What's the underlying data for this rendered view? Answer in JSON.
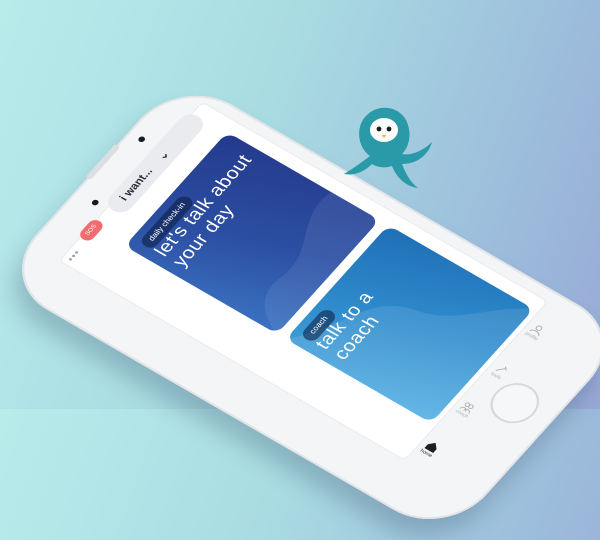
{
  "header": {
    "want_label": "i want...",
    "pill_label": "SOS"
  },
  "cards": [
    {
      "tag": "daily check-in",
      "text": "let's talk about your day"
    },
    {
      "tag": "coach",
      "text": "talk to a coach"
    }
  ],
  "tabs": [
    {
      "label": "home",
      "icon": "home-icon",
      "active": true
    },
    {
      "label": "coach",
      "icon": "people-icon",
      "active": false
    },
    {
      "label": "tools",
      "icon": "tools-icon",
      "active": false
    },
    {
      "label": "profile",
      "icon": "profile-icon",
      "active": false
    }
  ],
  "colors": {
    "checkin_card": "#2c4fa3",
    "coach_card": "#2f8ccd",
    "sos_pill": "#f16c6c",
    "mascot": "#2a9aa8"
  }
}
